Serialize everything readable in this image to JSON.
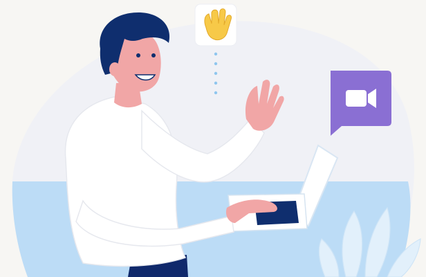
{
  "scene": {
    "description_icons": [
      "waving-hand-icon",
      "video-camera-icon"
    ],
    "colors": {
      "background": "#f7f6f3",
      "backdrop_blob": "#f0f1f6",
      "desk": "#bcdcf6",
      "hair": "#0f2e6e",
      "skin": "#f1a6a6",
      "sweater": "#ffffff",
      "pants": "#10296b",
      "laptop": "#ffffff",
      "laptop_screen": "#0f2e6e",
      "video_badge": "#8a6fd3",
      "hand_emoji": "#f7c948",
      "dots": "#8fc6ee"
    }
  }
}
